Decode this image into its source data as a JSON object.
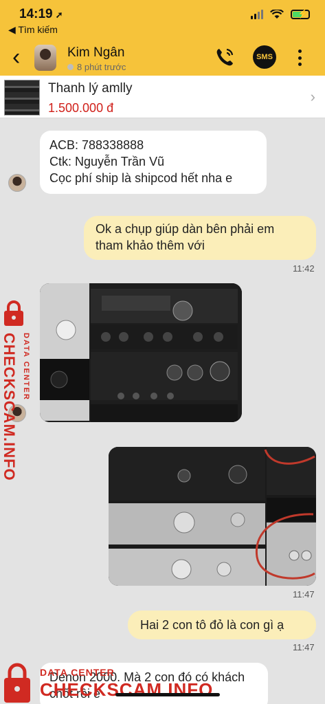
{
  "status_bar": {
    "time": "14:19",
    "back_app": "◀ Tìm kiếm"
  },
  "header": {
    "contact_name": "Kim Ngân",
    "last_seen": "8 phút trước",
    "sms_label": "SMS",
    "accent_color": "#f6c33a"
  },
  "product": {
    "title": "Thanh lý amlly",
    "price": "1.500.000 đ",
    "price_color": "#d0201a"
  },
  "messages": [
    {
      "direction": "in",
      "lines": [
        "ACB: 788338888",
        "Ctk: Nguyễn Trần Vũ",
        "Cọc phí ship là shipcod hết nha e"
      ]
    },
    {
      "direction": "out",
      "lines": [
        "Ok a chụp giúp dàn bên phải em",
        "tham khảo thêm với"
      ],
      "time": "11:42"
    },
    {
      "direction": "in",
      "type": "photo",
      "icon": "amplifier-photo"
    },
    {
      "direction": "out",
      "type": "photo",
      "icon": "amplifier-photo",
      "time": "11:47"
    },
    {
      "direction": "out",
      "lines": [
        "Hai 2 con tô đỏ là con gì ạ"
      ],
      "time": "11:47"
    },
    {
      "direction": "in",
      "lines": [
        "Denon 2000. Mà 2 con đó có khách",
        "chốt rồi e"
      ]
    }
  ],
  "watermark": {
    "label": "DATA CENTER",
    "site": "CHECKSCAM.INFO",
    "color": "#d02a22"
  }
}
